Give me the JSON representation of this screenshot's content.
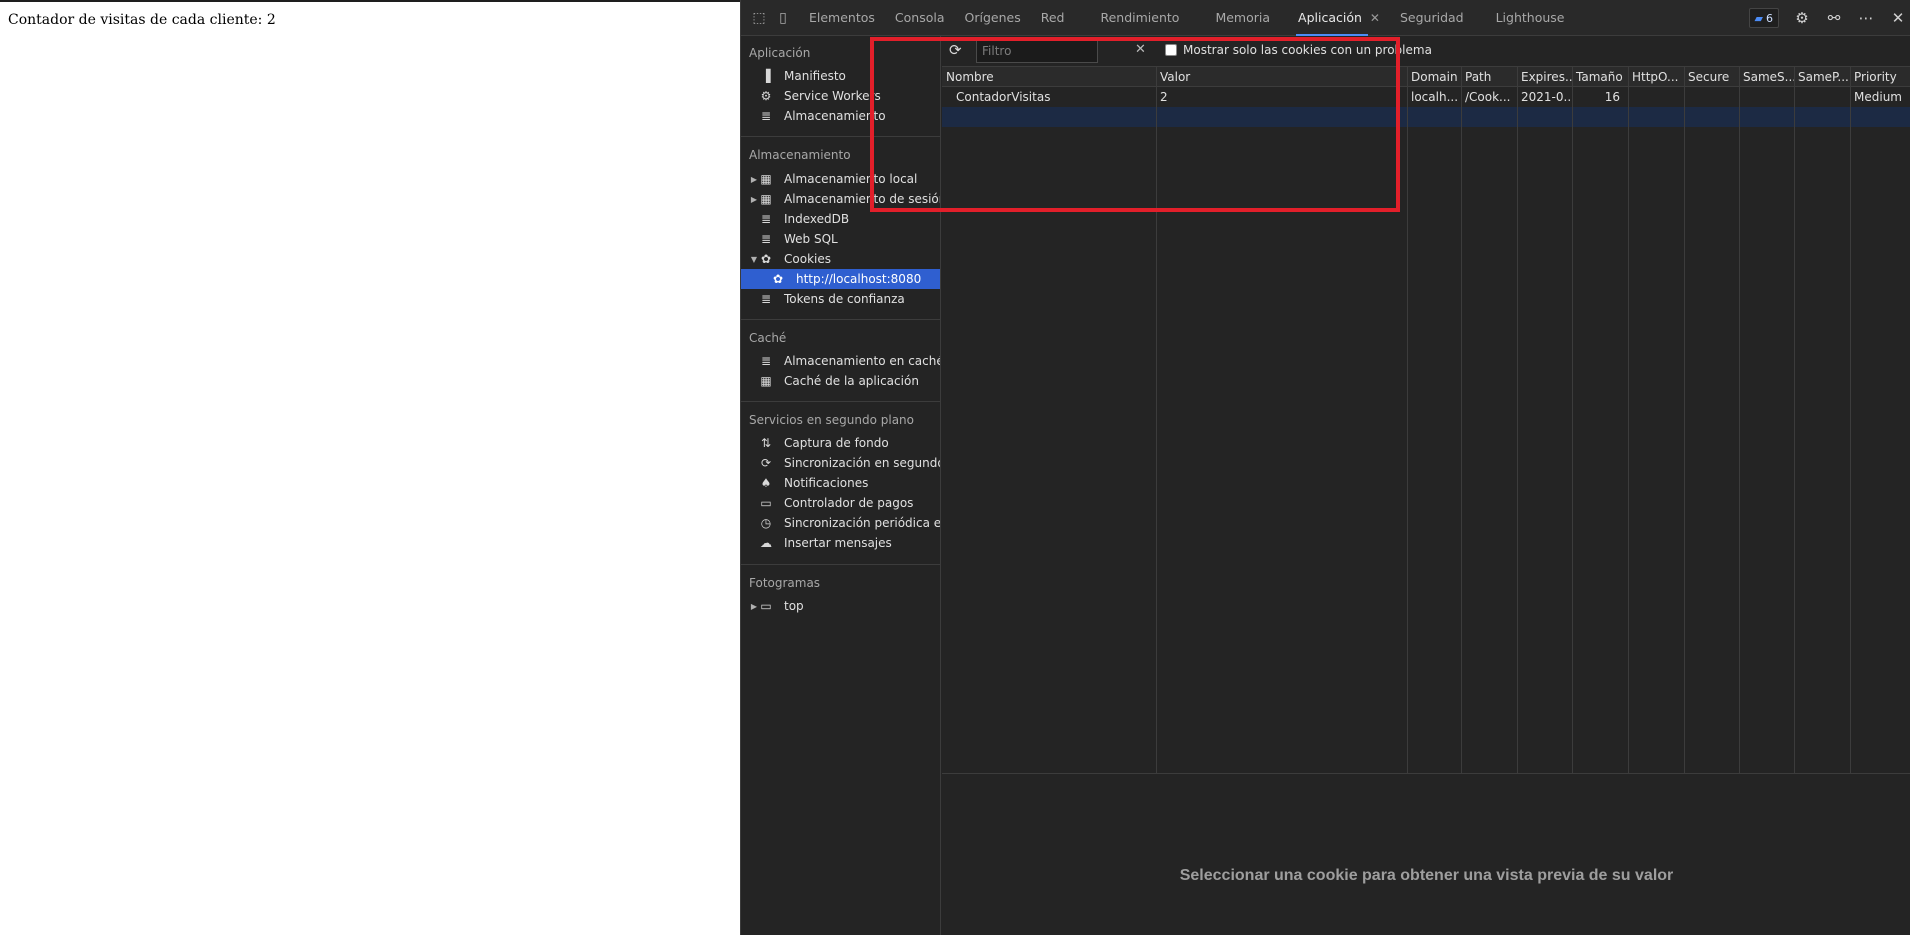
{
  "page": {
    "text": "Contador de visitas de cada cliente: 2"
  },
  "devtools": {
    "tabs": [
      {
        "label": "Elementos"
      },
      {
        "label": "Consola"
      },
      {
        "label": "Orígenes"
      },
      {
        "label": "Red"
      },
      {
        "label": "Rendimiento"
      },
      {
        "label": "Memoria"
      },
      {
        "label": "Aplicación",
        "active": true
      },
      {
        "label": "Seguridad"
      },
      {
        "label": "Lighthouse"
      }
    ],
    "issues_count": "6",
    "accent_color": "#4c8cf6",
    "highlight_color": "#e21f2a"
  },
  "sidebar": {
    "sections": {
      "app": "Aplicación",
      "storage": "Almacenamiento",
      "cache": "Caché",
      "background": "Servicios en segundo plano",
      "frames": "Fotogramas"
    },
    "items": {
      "manifest": "Manifiesto",
      "service_workers": "Service Workers",
      "storage": "Almacenamiento",
      "local_storage": "Almacenamiento local",
      "session_storage": "Almacenamiento de sesión",
      "indexeddb": "IndexedDB",
      "websql": "Web SQL",
      "cookies": "Cookies",
      "cookie_origin": "http://localhost:8080",
      "trust_tokens": "Tokens de confianza",
      "cache_storage": "Almacenamiento en caché",
      "app_cache": "Caché de la aplicación",
      "bg_fetch": "Captura de fondo",
      "bg_sync": "Sincronización en segundo plano",
      "notifications": "Notificaciones",
      "payment_handler": "Controlador de pagos",
      "periodic_sync": "Sincronización periódica en segundo plano",
      "push": "Insertar mensajes",
      "top": "top"
    }
  },
  "cookies": {
    "filter_placeholder": "Filtro",
    "only_issues_label": "Mostrar solo las cookies con un problema",
    "columns": [
      "Nombre",
      "Valor",
      "Domain",
      "Path",
      "Expires...",
      "Tamaño",
      "HttpO...",
      "Secure",
      "SameS...",
      "SameP...",
      "Priority"
    ],
    "rows": [
      {
        "name": "ContadorVisitas",
        "value": "2",
        "domain": "localh...",
        "path": "/Cook...",
        "expires": "2021-0...",
        "size": "16",
        "httponly": "",
        "secure": "",
        "samesite": "",
        "sameparty": "",
        "priority": "Medium"
      }
    ],
    "preview_text": "Seleccionar una cookie para obtener una vista previa de su valor"
  }
}
